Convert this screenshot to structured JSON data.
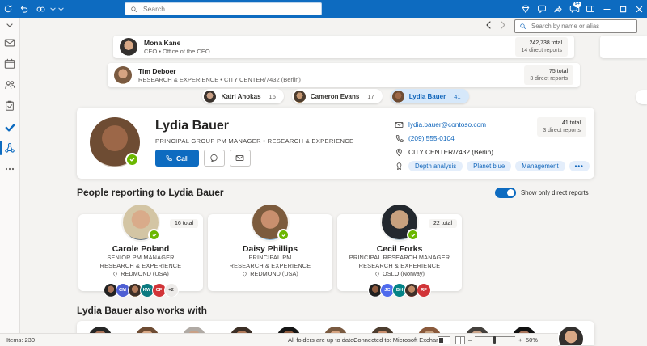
{
  "titlebar": {
    "search_placeholder": "Search",
    "chat_badge": "9+"
  },
  "topbar": {
    "people_search_placeholder": "Search by name or alias"
  },
  "sidebar": {
    "icons": [
      "chevron-down-icon",
      "mail-icon",
      "calendar-icon",
      "people-icon",
      "tasks-icon",
      "todo-check-icon",
      "org-chart-icon",
      "more-icon"
    ],
    "selected": "org-chart-icon"
  },
  "hierarchy": {
    "rows": [
      {
        "name": "Mona Kane",
        "subtitle": "CEO • Office of the CEO",
        "total": "242,738 total",
        "direct_reports": "14 direct reports"
      },
      {
        "name": "Tim Deboer",
        "subtitle": "RESEARCH & EXPERIENCE • CITY CENTER/7432 (Berlin)",
        "total": "75 total",
        "direct_reports": "3 direct reports"
      }
    ],
    "peers": [
      {
        "name": "Katri Ahokas",
        "count": "16",
        "selected": false
      },
      {
        "name": "Cameron Evans",
        "count": "17",
        "selected": false
      },
      {
        "name": "Lydia Bauer",
        "count": "41",
        "selected": true
      }
    ]
  },
  "profile": {
    "name": "Lydia Bauer",
    "title": "PRINCIPAL GROUP PM MANAGER • RESEARCH & EXPERIENCE",
    "call_label": "Call",
    "email": "lydia.bauer@contoso.com",
    "phone": "(209) 555-0104",
    "location": "CITY CENTER/7432 (Berlin)",
    "tags": [
      "Depth analysis",
      "Planet blue",
      "Management"
    ],
    "tags_more": "•••",
    "total": "41 total",
    "direct_reports": "3 direct reports"
  },
  "reports_section": {
    "heading": "People reporting to Lydia Bauer",
    "toggle_label": "Show only direct reports",
    "toggle_on": true,
    "cards": [
      {
        "name": "Carole Poland",
        "title": "SENIOR PM MANAGER",
        "org": "RESEARCH & EXPERIENCE",
        "location": "REDMOND (USA)",
        "total": "16 total",
        "team": [
          {
            "photo": "t1"
          },
          {
            "initials": "CM",
            "color": "#4e5fd3"
          },
          {
            "photo": "t2"
          },
          {
            "initials": "KW",
            "color": "#0b7a80"
          },
          {
            "initials": "CF",
            "color": "#d13438"
          },
          {
            "more": "+2"
          }
        ]
      },
      {
        "name": "Daisy Phillips",
        "title": "PRINCIPAL PM",
        "org": "RESEARCH & EXPERIENCE",
        "location": "REDMOND (USA)",
        "total": "",
        "team": []
      },
      {
        "name": "Cecil Forks",
        "title": "PRINCIPAL RESEARCH MANAGER",
        "org": "RESEARCH & EXPERIENCE",
        "location": "OSLO (Norway)",
        "total": "22 total",
        "team": [
          {
            "photo": "t3"
          },
          {
            "initials": "JC",
            "color": "#4f6bed"
          },
          {
            "initials": "BH",
            "color": "#038387"
          },
          {
            "photo": "t4"
          },
          {
            "initials": "RF",
            "color": "#d13438"
          }
        ]
      }
    ]
  },
  "works_with": {
    "heading": "Lydia Bauer also works with",
    "avatars": [
      "a",
      "b",
      "c",
      "d",
      "e",
      "f",
      "g",
      "h",
      "i",
      "j",
      "k"
    ]
  },
  "statusbar": {
    "items": "Items: 230",
    "folders": "All folders are up to date.",
    "connected": "Connected to: Microsoft Exchange",
    "zoom": "50%"
  },
  "colors": {
    "accent": "#0d6bc0",
    "link": "#1166bb",
    "presence_green": "#6bb700",
    "selected_chip_bg": "#d6e8fa",
    "tag_bg": "#e4eefb"
  }
}
